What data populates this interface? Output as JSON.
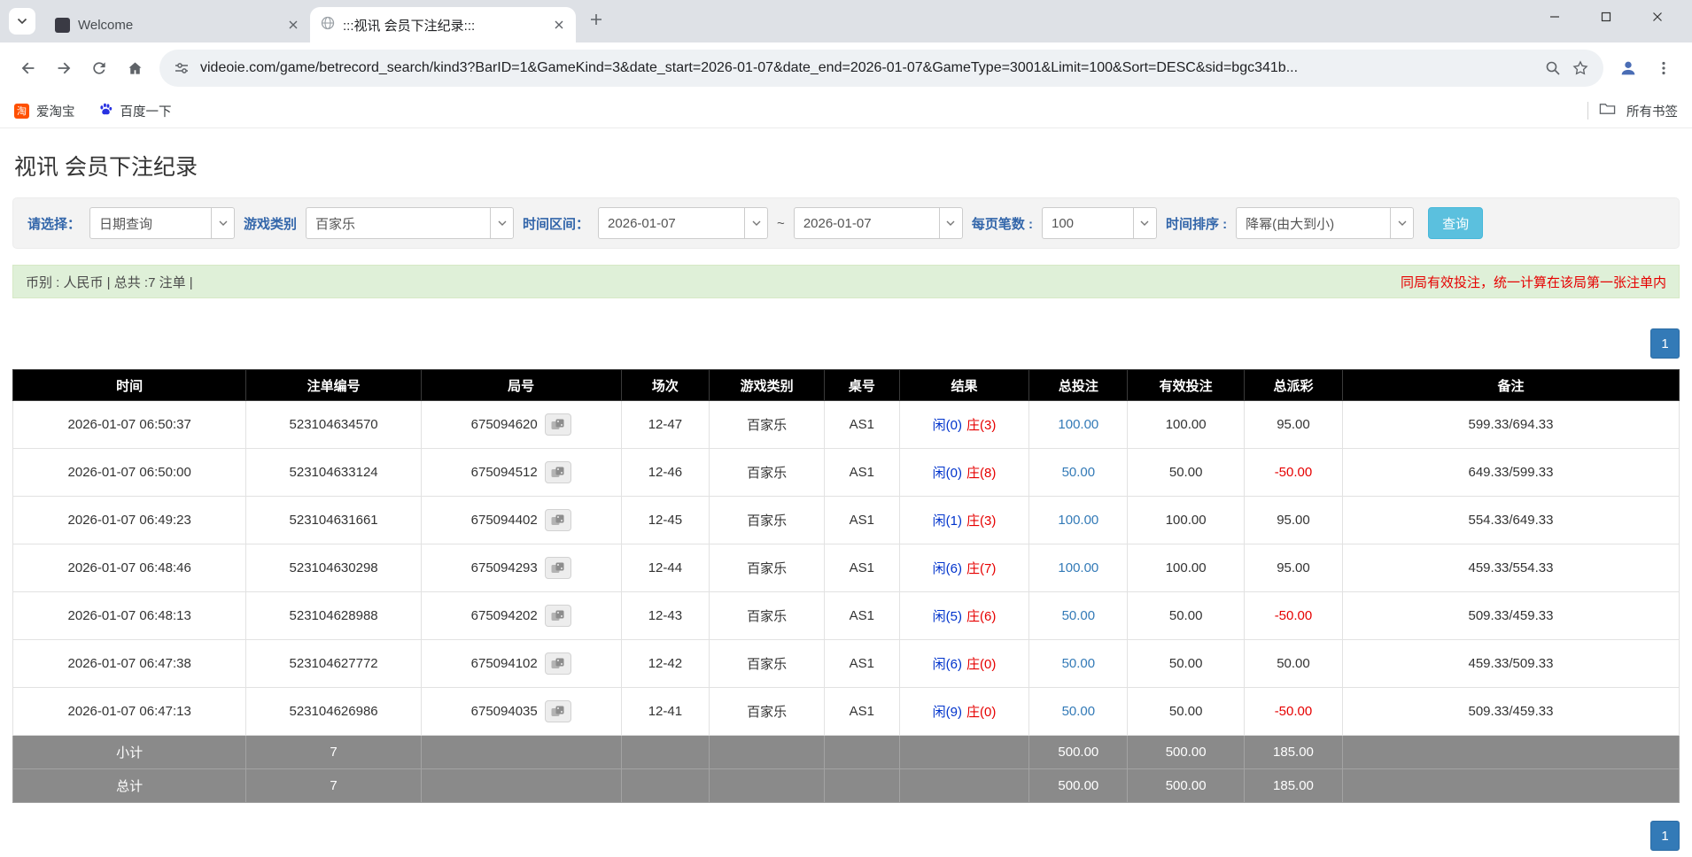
{
  "browser": {
    "tabs": [
      {
        "title": "Welcome"
      },
      {
        "title": ":::视讯 会员下注纪录:::"
      }
    ],
    "url": "videoie.com/game/betrecord_search/kind3?BarID=1&GameKind=3&date_start=2026-01-07&date_end=2026-01-07&GameType=3001&Limit=100&Sort=DESC&sid=bgc341b...",
    "bookmarks": [
      {
        "label": "爱淘宝",
        "icon_text": "淘"
      },
      {
        "label": "百度一下"
      }
    ],
    "bookmarks_right": "所有书签"
  },
  "page": {
    "title": "视讯 会员下注纪录",
    "filters": {
      "select_label": "请选择：",
      "select_value": "日期查询",
      "game_label": "游戏类别",
      "game_value": "百家乐",
      "range_label": "时间区间：",
      "date_start": "2026-01-07",
      "range_sep": "~",
      "date_end": "2026-01-07",
      "per_page_label": "每页笔数 :",
      "per_page_value": "100",
      "sort_label": "时间排序 :",
      "sort_value": "降幂(由大到小)",
      "search_button": "查询"
    },
    "info": {
      "summary": "币别 : 人民币 | 总共 :7 注单 |",
      "notice": "同局有效投注，统一计算在该局第一张注单内"
    },
    "pagination": {
      "page": "1"
    },
    "table": {
      "headers": [
        "时间",
        "注单编号",
        "局号",
        "场次",
        "游戏类别",
        "桌号",
        "结果",
        "总投注",
        "有效投注",
        "总派彩",
        "备注"
      ],
      "rows": [
        {
          "time": "2026-01-07 06:50:37",
          "bet_no": "523104634570",
          "round_no": "675094620",
          "session": "12-47",
          "game": "百家乐",
          "table_no": "AS1",
          "player": "闲(0)",
          "banker": "庄(3)",
          "total_bet": "100.00",
          "valid_bet": "100.00",
          "payout": "95.00",
          "remark": "599.33/694.33"
        },
        {
          "time": "2026-01-07 06:50:00",
          "bet_no": "523104633124",
          "round_no": "675094512",
          "session": "12-46",
          "game": "百家乐",
          "table_no": "AS1",
          "player": "闲(0)",
          "banker": "庄(8)",
          "total_bet": "50.00",
          "valid_bet": "50.00",
          "payout": "-50.00",
          "remark": "649.33/599.33"
        },
        {
          "time": "2026-01-07 06:49:23",
          "bet_no": "523104631661",
          "round_no": "675094402",
          "session": "12-45",
          "game": "百家乐",
          "table_no": "AS1",
          "player": "闲(1)",
          "banker": "庄(3)",
          "total_bet": "100.00",
          "valid_bet": "100.00",
          "payout": "95.00",
          "remark": "554.33/649.33"
        },
        {
          "time": "2026-01-07 06:48:46",
          "bet_no": "523104630298",
          "round_no": "675094293",
          "session": "12-44",
          "game": "百家乐",
          "table_no": "AS1",
          "player": "闲(6)",
          "banker": "庄(7)",
          "total_bet": "100.00",
          "valid_bet": "100.00",
          "payout": "95.00",
          "remark": "459.33/554.33"
        },
        {
          "time": "2026-01-07 06:48:13",
          "bet_no": "523104628988",
          "round_no": "675094202",
          "session": "12-43",
          "game": "百家乐",
          "table_no": "AS1",
          "player": "闲(5)",
          "banker": "庄(6)",
          "total_bet": "50.00",
          "valid_bet": "50.00",
          "payout": "-50.00",
          "remark": "509.33/459.33"
        },
        {
          "time": "2026-01-07 06:47:38",
          "bet_no": "523104627772",
          "round_no": "675094102",
          "session": "12-42",
          "game": "百家乐",
          "table_no": "AS1",
          "player": "闲(6)",
          "banker": "庄(0)",
          "total_bet": "50.00",
          "valid_bet": "50.00",
          "payout": "50.00",
          "remark": "459.33/509.33"
        },
        {
          "time": "2026-01-07 06:47:13",
          "bet_no": "523104626986",
          "round_no": "675094035",
          "session": "12-41",
          "game": "百家乐",
          "table_no": "AS1",
          "player": "闲(9)",
          "banker": "庄(0)",
          "total_bet": "50.00",
          "valid_bet": "50.00",
          "payout": "-50.00",
          "remark": "509.33/459.33"
        }
      ],
      "subtotal": {
        "label": "小计",
        "count": "7",
        "total_bet": "500.00",
        "valid_bet": "500.00",
        "payout": "185.00"
      },
      "total": {
        "label": "总计",
        "count": "7",
        "total_bet": "500.00",
        "valid_bet": "500.00",
        "payout": "185.00"
      }
    },
    "colors": {
      "accent_blue": "#337ab7",
      "search_button": "#5bc0de",
      "player_blue": "#0033cc",
      "banker_red": "#e60000",
      "negative_red": "#e60000",
      "info_bar_bg": "#dff0d8",
      "table_header_bg": "#000000",
      "summary_row_bg": "#8a8a8a"
    }
  }
}
